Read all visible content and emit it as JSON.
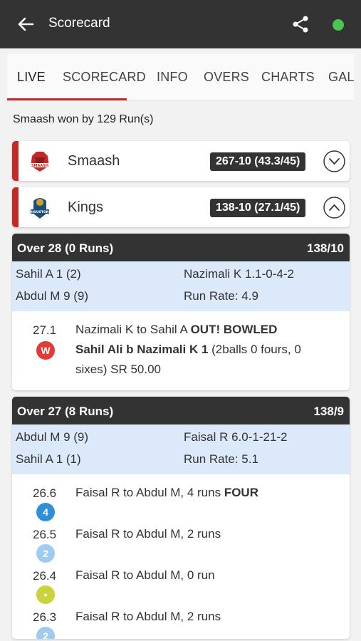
{
  "app": {
    "title": "Scorecard",
    "status_color": "#4cc552",
    "icons": {
      "back": "arrow-left-icon",
      "share": "share-icon"
    }
  },
  "tabs": [
    {
      "label": "LIVE",
      "active": true
    },
    {
      "label": "SCORECARD",
      "active": false
    },
    {
      "label": "INFO",
      "active": false
    },
    {
      "label": "OVERS",
      "active": false
    },
    {
      "label": "CHARTS",
      "active": false
    },
    {
      "label": "GALLERY",
      "active": false
    }
  ],
  "result": "Smaash won by 129 Run(s)",
  "teams": [
    {
      "name": "Smaash",
      "score": "267-10 (43.3/45)",
      "logo_text": "SMAASH",
      "expanded": false
    },
    {
      "name": "Kings",
      "score": "138-10 (27.1/45)",
      "logo_text": "HOUSTON",
      "expanded": true
    }
  ],
  "overs": [
    {
      "header_left": "Over 28 (0 Runs)",
      "header_right": "138/10",
      "batter1": "Sahil A 1 (2)",
      "batter2": "Abdul M 9 (9)",
      "bowler": "Nazimali K 1.1-0-4-2",
      "run_rate": "Run Rate: 4.9",
      "balls": [
        {
          "num": "27.1",
          "badge": "W",
          "badge_color": "#e53935",
          "text_a": "Nazimali K to Sahil A ",
          "text_b": "OUT! BOWLED",
          "text_c": "Sahil Ali b Nazimali K 1",
          "text_d": " (2balls 0 fours, 0 sixes) SR 50.00"
        }
      ]
    },
    {
      "header_left": "Over 27 (8 Runs)",
      "header_right": "138/9",
      "batter1": "Abdul M 9 (9)",
      "batter2": "Sahil A 1 (1)",
      "bowler": "Faisal R 6.0-1-21-2",
      "run_rate": "Run Rate: 5.1",
      "balls": [
        {
          "num": "26.6",
          "badge": "4",
          "badge_color": "#2f8fd8",
          "text_a": "Faisal R to Abdul M, 4 runs ",
          "text_b": "FOUR"
        },
        {
          "num": "26.5",
          "badge": "2",
          "badge_color": "#9ecbee",
          "text_a": "Faisal R to Abdul M, 2 runs",
          "text_b": ""
        },
        {
          "num": "26.4",
          "badge": "•",
          "badge_color": "#c9d33c",
          "text_a": "Faisal R to Abdul M, 0 run",
          "text_b": ""
        },
        {
          "num": "26.3",
          "badge": "2",
          "badge_color": "#9ecbee",
          "text_a": "Faisal R to Abdul M, 2 runs",
          "text_b": ""
        }
      ]
    }
  ]
}
